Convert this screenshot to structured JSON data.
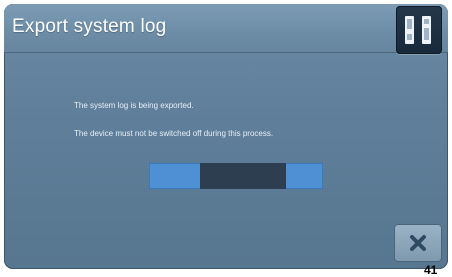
{
  "dialog": {
    "title": "Export system log",
    "messages": {
      "line1": "The system log is being exported.",
      "line2": "The device must not be switched off during this process."
    },
    "progress": {
      "indeterminate": true,
      "track_color": "#4f8fd3",
      "indicator_color": "#2c3e50"
    },
    "icons": {
      "top_right": "device-status-icon",
      "close": "close-icon"
    }
  },
  "page_number": "41"
}
